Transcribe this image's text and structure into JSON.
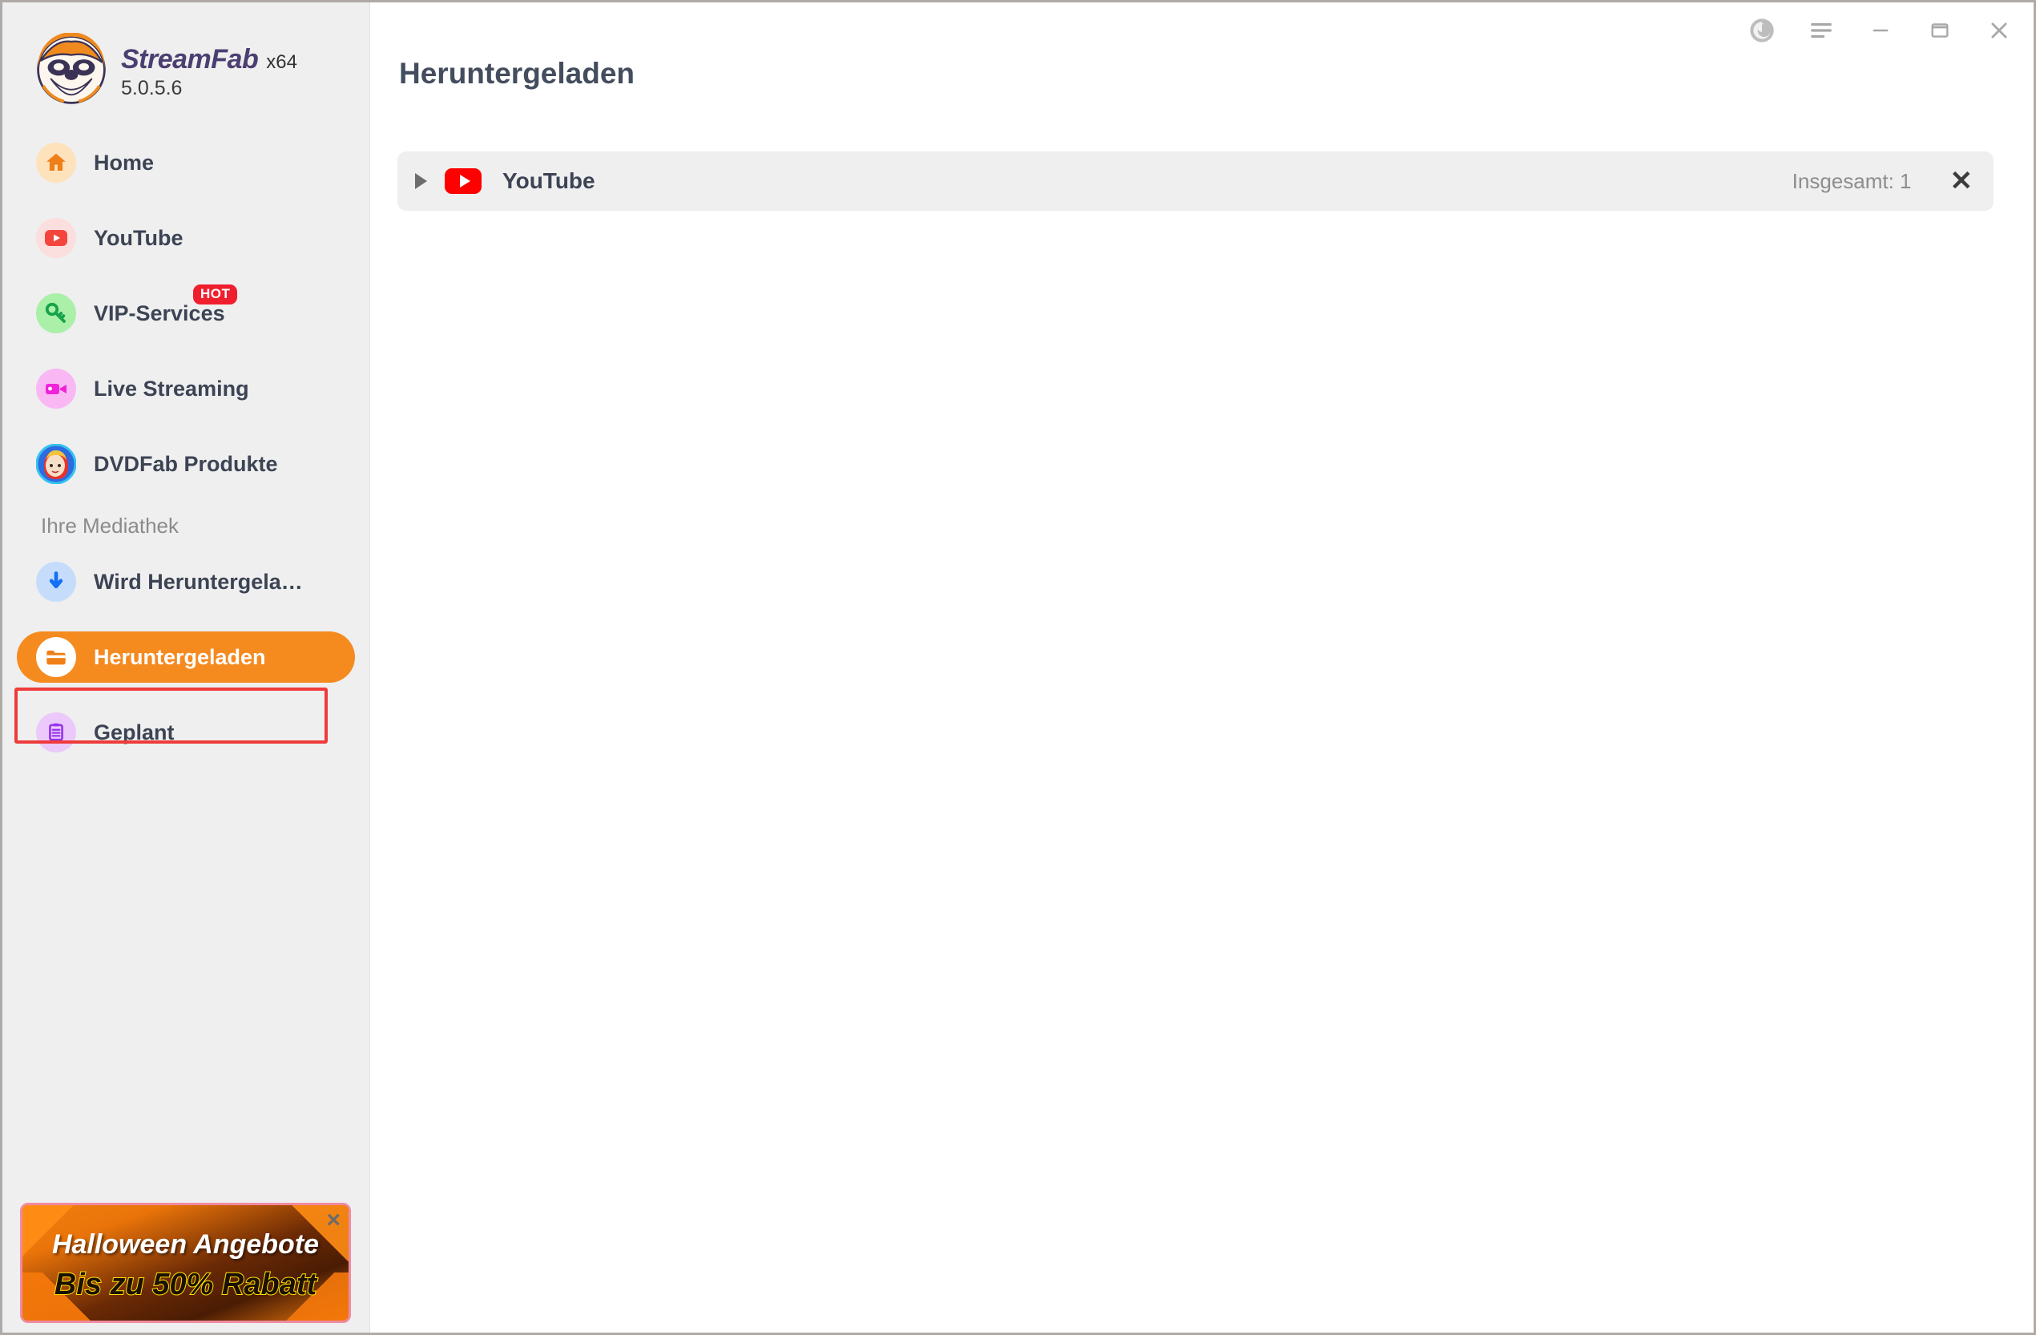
{
  "app": {
    "brand_name": "StreamFab",
    "arch": "x64",
    "version": "5.0.5.6"
  },
  "titlebar": {
    "buttons": [
      {
        "name": "disc-icon",
        "label": ""
      },
      {
        "name": "menu-icon",
        "label": ""
      },
      {
        "name": "minimize-icon",
        "label": ""
      },
      {
        "name": "maximize-icon",
        "label": ""
      },
      {
        "name": "close-icon",
        "label": ""
      }
    ]
  },
  "sidebar": {
    "items": [
      {
        "label": "Home",
        "icon": "home-icon",
        "badge": null
      },
      {
        "label": "YouTube",
        "icon": "youtube-icon",
        "badge": null
      },
      {
        "label": "VIP-Services",
        "icon": "key-icon",
        "badge": "HOT"
      },
      {
        "label": "Live Streaming",
        "icon": "video-camera-icon",
        "badge": null
      },
      {
        "label": "DVDFab Produkte",
        "icon": "dvdfab-icon",
        "badge": null
      }
    ],
    "section_title": "Ihre Mediathek",
    "library_items": [
      {
        "label": "Wird Heruntergela…",
        "icon": "download-arrow-icon",
        "active": false
      },
      {
        "label": "Heruntergeladen",
        "icon": "folder-icon",
        "active": true
      },
      {
        "label": "Geplant",
        "icon": "clipboard-icon",
        "active": false
      }
    ]
  },
  "banner": {
    "line1": "Halloween Angebote",
    "line2": "Bis zu 50% Rabatt",
    "close": "×"
  },
  "main": {
    "page_title": "Heruntergeladen",
    "groups": [
      {
        "name": "YouTube",
        "count_label": "Insgesamt: 1",
        "expanded": false,
        "close": "✕"
      }
    ]
  },
  "colors": {
    "accent": "#f58a1f",
    "sidebar_bg": "#efefef",
    "text": "#3c4454",
    "muted": "#8d8d8d",
    "annotation": "#ef3b3b",
    "youtube_red": "#ff0000"
  }
}
